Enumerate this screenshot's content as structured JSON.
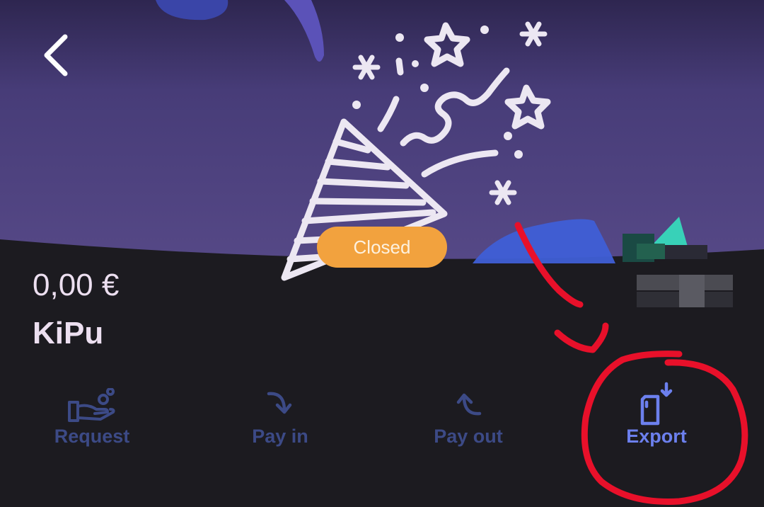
{
  "header": {
    "back_icon": "chevron-left-icon"
  },
  "hero": {
    "illustration": "party-popper-icon",
    "status": "Closed"
  },
  "account": {
    "balance": "0,00 €",
    "name": "KiPu"
  },
  "actions": [
    {
      "label": "Request",
      "icon": "hand-coins-icon"
    },
    {
      "label": "Pay in",
      "icon": "curved-arrow-down-icon"
    },
    {
      "label": "Pay out",
      "icon": "curved-arrow-up-icon"
    },
    {
      "label": "Export",
      "icon": "document-download-icon"
    }
  ],
  "colors": {
    "background": "#1c1b20",
    "hero_purple": "#4a3f7c",
    "badge": "#f2a23e",
    "action_muted": "#3c4a86",
    "action_active": "#6c80ee",
    "annotation": "#e8102a"
  }
}
